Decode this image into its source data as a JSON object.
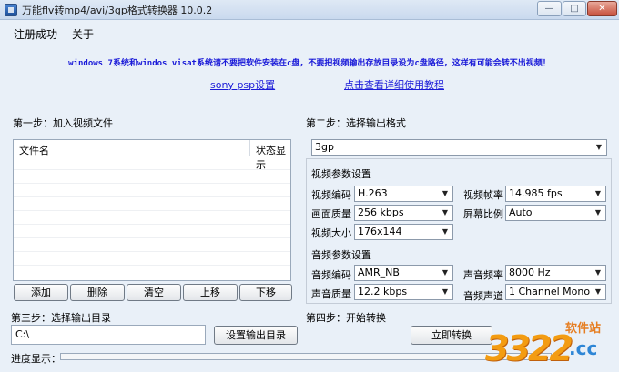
{
  "window": {
    "title": "万能flv转mp4/avi/3gp格式转换器 10.0.2",
    "min_label": "—",
    "max_label": "□",
    "close_label": "✕"
  },
  "menu": {
    "items": [
      "注册成功",
      "关于"
    ]
  },
  "notice": "windows 7系统和windos visat系统请不要把软件安装在c盘，不要把视频输出存放目录设为c盘路径，这样有可能会转不出视频！",
  "links": {
    "sony_psp": "sony psp设置",
    "help": "点击查看详细使用教程"
  },
  "step1": {
    "label": "第一步：加入视频文件",
    "columns": [
      "文件名",
      "状态显示"
    ],
    "buttons": [
      "添加",
      "删除",
      "清空",
      "上移",
      "下移"
    ]
  },
  "step2": {
    "label": "第二步：选择输出格式",
    "format": "3gp",
    "video": {
      "title": "视频参数设置",
      "codec_label": "视频编码",
      "codec": "H.263",
      "fps_label": "视频帧率",
      "fps": "14.985 fps",
      "quality_label": "画面质量",
      "quality": "256 kbps",
      "aspect_label": "屏幕比例",
      "aspect": "Auto",
      "size_label": "视频大小",
      "size": "176x144"
    },
    "audio": {
      "title": "音频参数设置",
      "codec_label": "音频编码",
      "codec": "AMR_NB",
      "rate_label": "声音频率",
      "rate": "8000 Hz",
      "quality_label": "声音质量",
      "quality": "12.2 kbps",
      "channel_label": "音频声道",
      "channel": "1 Channel Mono"
    }
  },
  "step3": {
    "label": "第三步：选择输出目录",
    "path": "C:\\",
    "button": "设置输出目录"
  },
  "step4": {
    "label": "第四步：开始转换",
    "button": "立即转换"
  },
  "progress": {
    "label": "进度显示：",
    "value": 0
  },
  "watermark": {
    "digits": "3322",
    "cn": "软件站",
    "cc": ".cc"
  }
}
